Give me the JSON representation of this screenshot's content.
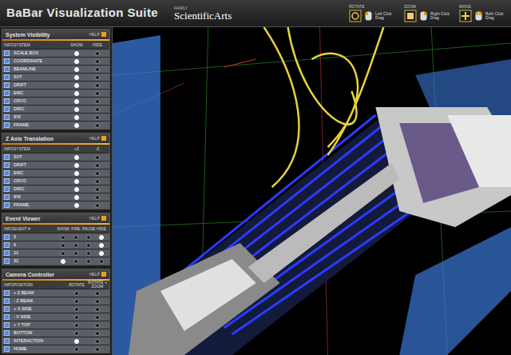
{
  "header": {
    "title": "BaBar Visualization Suite",
    "family_label": "FAMILY",
    "logo": "ScientificArts",
    "controls": [
      {
        "label": "ROTATE",
        "hint": "Left Click Drag"
      },
      {
        "label": "ZOOM",
        "hint": "Right Click Drag"
      },
      {
        "label": "MOVE",
        "hint": "Both Click Drag"
      }
    ]
  },
  "panels": [
    {
      "title": "System Visibility",
      "help": "HELP",
      "columns": [
        "INFO",
        "SYSTEM",
        "SHOW",
        "HIDE"
      ],
      "rows": [
        {
          "name": "SCALE BOX",
          "choices": [
            {
              "selected": true
            },
            {
              "selected": false
            }
          ]
        },
        {
          "name": "COORDINATE",
          "choices": [
            {
              "selected": true
            },
            {
              "selected": false
            }
          ]
        },
        {
          "name": "BEAMLINE",
          "choices": [
            {
              "selected": true
            },
            {
              "selected": false
            }
          ]
        },
        {
          "name": "SVT",
          "choices": [
            {
              "selected": true
            },
            {
              "selected": false
            }
          ]
        },
        {
          "name": "DRIFT",
          "choices": [
            {
              "selected": true
            },
            {
              "selected": false
            }
          ]
        },
        {
          "name": "EMC",
          "choices": [
            {
              "selected": true
            },
            {
              "selected": false
            }
          ]
        },
        {
          "name": "CRYO",
          "choices": [
            {
              "selected": true
            },
            {
              "selected": false
            }
          ]
        },
        {
          "name": "DIRC",
          "choices": [
            {
              "selected": true
            },
            {
              "selected": false
            }
          ]
        },
        {
          "name": "IFR",
          "choices": [
            {
              "selected": true
            },
            {
              "selected": false
            }
          ]
        },
        {
          "name": "FRAME",
          "choices": [
            {
              "selected": true
            },
            {
              "selected": false
            }
          ]
        }
      ]
    },
    {
      "title": "Z Axis Translation",
      "help": "HELP",
      "columns": [
        "INFO",
        "SYSTEM",
        "+Z",
        "-Z"
      ],
      "rows": [
        {
          "name": "SVT",
          "choices": [
            {
              "selected": true
            },
            {
              "selected": false
            }
          ]
        },
        {
          "name": "DRIFT",
          "choices": [
            {
              "selected": true
            },
            {
              "selected": false
            }
          ]
        },
        {
          "name": "EMC",
          "choices": [
            {
              "selected": true
            },
            {
              "selected": false
            }
          ]
        },
        {
          "name": "CRYO",
          "choices": [
            {
              "selected": true
            },
            {
              "selected": false
            }
          ]
        },
        {
          "name": "DIRC",
          "choices": [
            {
              "selected": true
            },
            {
              "selected": false
            }
          ]
        },
        {
          "name": "IFR",
          "choices": [
            {
              "selected": true
            },
            {
              "selected": false
            }
          ]
        },
        {
          "name": "FRAME",
          "choices": [
            {
              "selected": true
            },
            {
              "selected": false
            }
          ]
        }
      ]
    },
    {
      "title": "Event Viewer",
      "help": "HELP",
      "columns": [
        "INFO",
        "EVENT #",
        "SHOW",
        "FIRE",
        "PAUSE",
        "HIDE"
      ],
      "rows": [
        {
          "name": "5",
          "choices": [
            {
              "selected": false
            },
            {
              "selected": false
            },
            {
              "selected": false
            },
            {
              "selected": true
            }
          ]
        },
        {
          "name": "6",
          "choices": [
            {
              "selected": false
            },
            {
              "selected": false
            },
            {
              "selected": false
            },
            {
              "selected": true
            }
          ]
        },
        {
          "name": "21",
          "choices": [
            {
              "selected": false
            },
            {
              "selected": false
            },
            {
              "selected": false
            },
            {
              "selected": true
            }
          ]
        },
        {
          "name": "32",
          "choices": [
            {
              "selected": true
            },
            {
              "selected": false
            },
            {
              "selected": false
            },
            {
              "selected": false
            }
          ]
        }
      ]
    },
    {
      "title": "Camera Controller",
      "help": "HELP",
      "columns": [
        "INFO",
        "POSITION",
        "ROTATE",
        "ROTATE + ZOOM"
      ],
      "rows": [
        {
          "name": "+ Z BEAM",
          "choices": [
            {
              "selected": false
            },
            {
              "selected": false
            }
          ]
        },
        {
          "name": "- Z BEAM",
          "choices": [
            {
              "selected": false
            },
            {
              "selected": false
            }
          ]
        },
        {
          "name": "+ X SIDE",
          "choices": [
            {
              "selected": false
            },
            {
              "selected": false
            }
          ]
        },
        {
          "name": "- X SIDE",
          "choices": [
            {
              "selected": false
            },
            {
              "selected": false
            }
          ]
        },
        {
          "name": "+ Y TOP",
          "choices": [
            {
              "selected": false
            },
            {
              "selected": false
            }
          ]
        },
        {
          "name": "BOTTOM",
          "choices": [
            {
              "selected": false
            },
            {
              "selected": false
            }
          ]
        },
        {
          "name": "INTERACTION",
          "choices": [
            {
              "selected": true
            },
            {
              "selected": false
            }
          ]
        },
        {
          "name": "HOME",
          "choices": [
            {
              "selected": false
            },
            {
              "selected": false
            }
          ]
        }
      ]
    }
  ]
}
